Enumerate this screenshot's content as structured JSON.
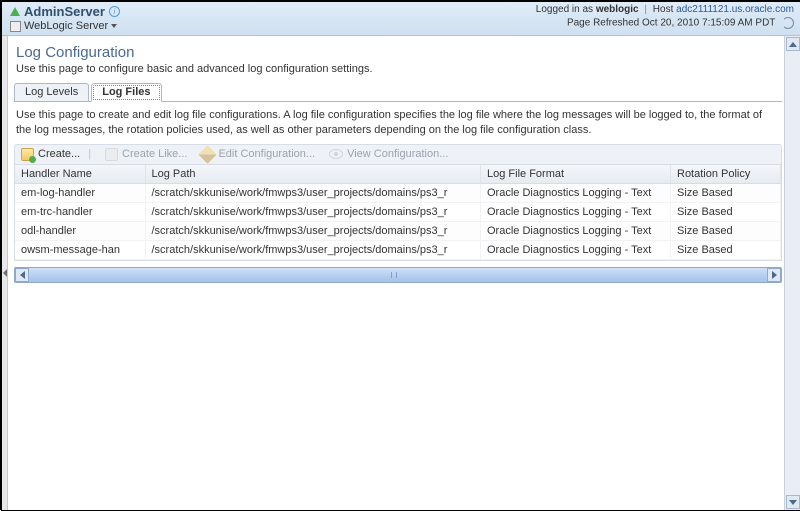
{
  "header": {
    "title": "AdminServer",
    "subtitle": "WebLogic Server",
    "logged_in_prefix": "Logged in as",
    "user": "weblogic",
    "host_label": "Host",
    "host": "adc2111121.us.oracle.com",
    "refresh_text": "Page Refreshed Oct 20, 2010 7:15:09 AM PDT"
  },
  "page": {
    "title": "Log Configuration",
    "desc": "Use this page to configure basic and advanced log configuration settings.",
    "tabs": [
      {
        "label": "Log Levels",
        "active": false
      },
      {
        "label": "Log Files",
        "active": true
      }
    ],
    "tab_desc": "Use this page to create and edit log file configurations. A log file configuration specifies the log file where the log messages will be logged to, the format of the log messages, the rotation policies used, as well as other parameters depending on the log file configuration class."
  },
  "toolbar": {
    "create": "Create...",
    "create_like": "Create Like...",
    "edit": "Edit Configuration...",
    "view": "View Configuration..."
  },
  "table": {
    "columns": [
      "Handler Name",
      "Log Path",
      "Log File Format",
      "Rotation Policy"
    ],
    "rows": [
      {
        "handler": "em-log-handler",
        "path": "/scratch/skkunise/work/fmwps3/user_projects/domains/ps3_r",
        "format": "Oracle Diagnostics Logging - Text",
        "policy": "Size Based"
      },
      {
        "handler": "em-trc-handler",
        "path": "/scratch/skkunise/work/fmwps3/user_projects/domains/ps3_r",
        "format": "Oracle Diagnostics Logging - Text",
        "policy": "Size Based"
      },
      {
        "handler": "odl-handler",
        "path": "/scratch/skkunise/work/fmwps3/user_projects/domains/ps3_r",
        "format": "Oracle Diagnostics Logging - Text",
        "policy": "Size Based"
      },
      {
        "handler": "owsm-message-han",
        "path": "/scratch/skkunise/work/fmwps3/user_projects/domains/ps3_r",
        "format": "Oracle Diagnostics Logging - Text",
        "policy": "Size Based"
      }
    ]
  }
}
